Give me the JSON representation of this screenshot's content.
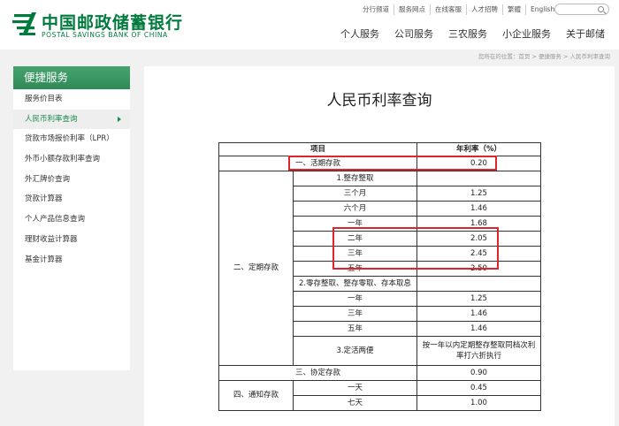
{
  "header": {
    "logo_cn": "中国邮政储蓄银行",
    "logo_en": "POSTAL SAVINGS BANK OF CHINA",
    "top_links": [
      "分行频道",
      "服务网点",
      "在线客服",
      "人才招聘",
      "繁體",
      "English"
    ],
    "nav": [
      "个人服务",
      "公司服务",
      "三农服务",
      "小企业服务",
      "关于邮储"
    ]
  },
  "breadcrumb": "您所在的位置：首页 > 便捷服务 > 人民币利率查询",
  "sidebar": {
    "title": "便捷服务",
    "items": [
      "服务价目表",
      "人民币利率查询",
      "贷款市场报价利率（LPR）",
      "外币小额存款利率查询",
      "外汇牌价查询",
      "贷款计算器",
      "个人产品信息查询",
      "理财收益计算器",
      "基金计算器"
    ],
    "active_index": 1
  },
  "main": {
    "title": "人民币利率查询",
    "table": {
      "headers": [
        "项目",
        "年利率（%）"
      ],
      "r1_label": "一、活期存款",
      "r1_rate": "0.20",
      "group2": "二、定期存款",
      "sub1": "1.整存整取",
      "sub1_rows": [
        {
          "term": "三个月",
          "rate": "1.25"
        },
        {
          "term": "六个月",
          "rate": "1.46"
        },
        {
          "term": "一年",
          "rate": "1.68"
        },
        {
          "term": "二年",
          "rate": "2.05"
        },
        {
          "term": "三年",
          "rate": "2.45"
        },
        {
          "term": "五年",
          "rate": "2.50"
        }
      ],
      "sub2": "2.零存整取、整存零取、存本取息",
      "sub2_rows": [
        {
          "term": "一年",
          "rate": "1.25"
        },
        {
          "term": "三年",
          "rate": "1.46"
        },
        {
          "term": "五年",
          "rate": "1.46"
        }
      ],
      "sub3": "3.定活两便",
      "sub3_rate": "按一年以内定期整存整取同档次利率打六折执行",
      "r3_label": "三、协定存款",
      "r3_rate": "0.90",
      "group4": "四、通知存款",
      "notice_rows": [
        {
          "term": "一天",
          "rate": "0.45"
        },
        {
          "term": "七天",
          "rate": "1.00"
        }
      ]
    }
  },
  "colors": {
    "brand": "#007a3d",
    "highlight": "#e0242e"
  }
}
